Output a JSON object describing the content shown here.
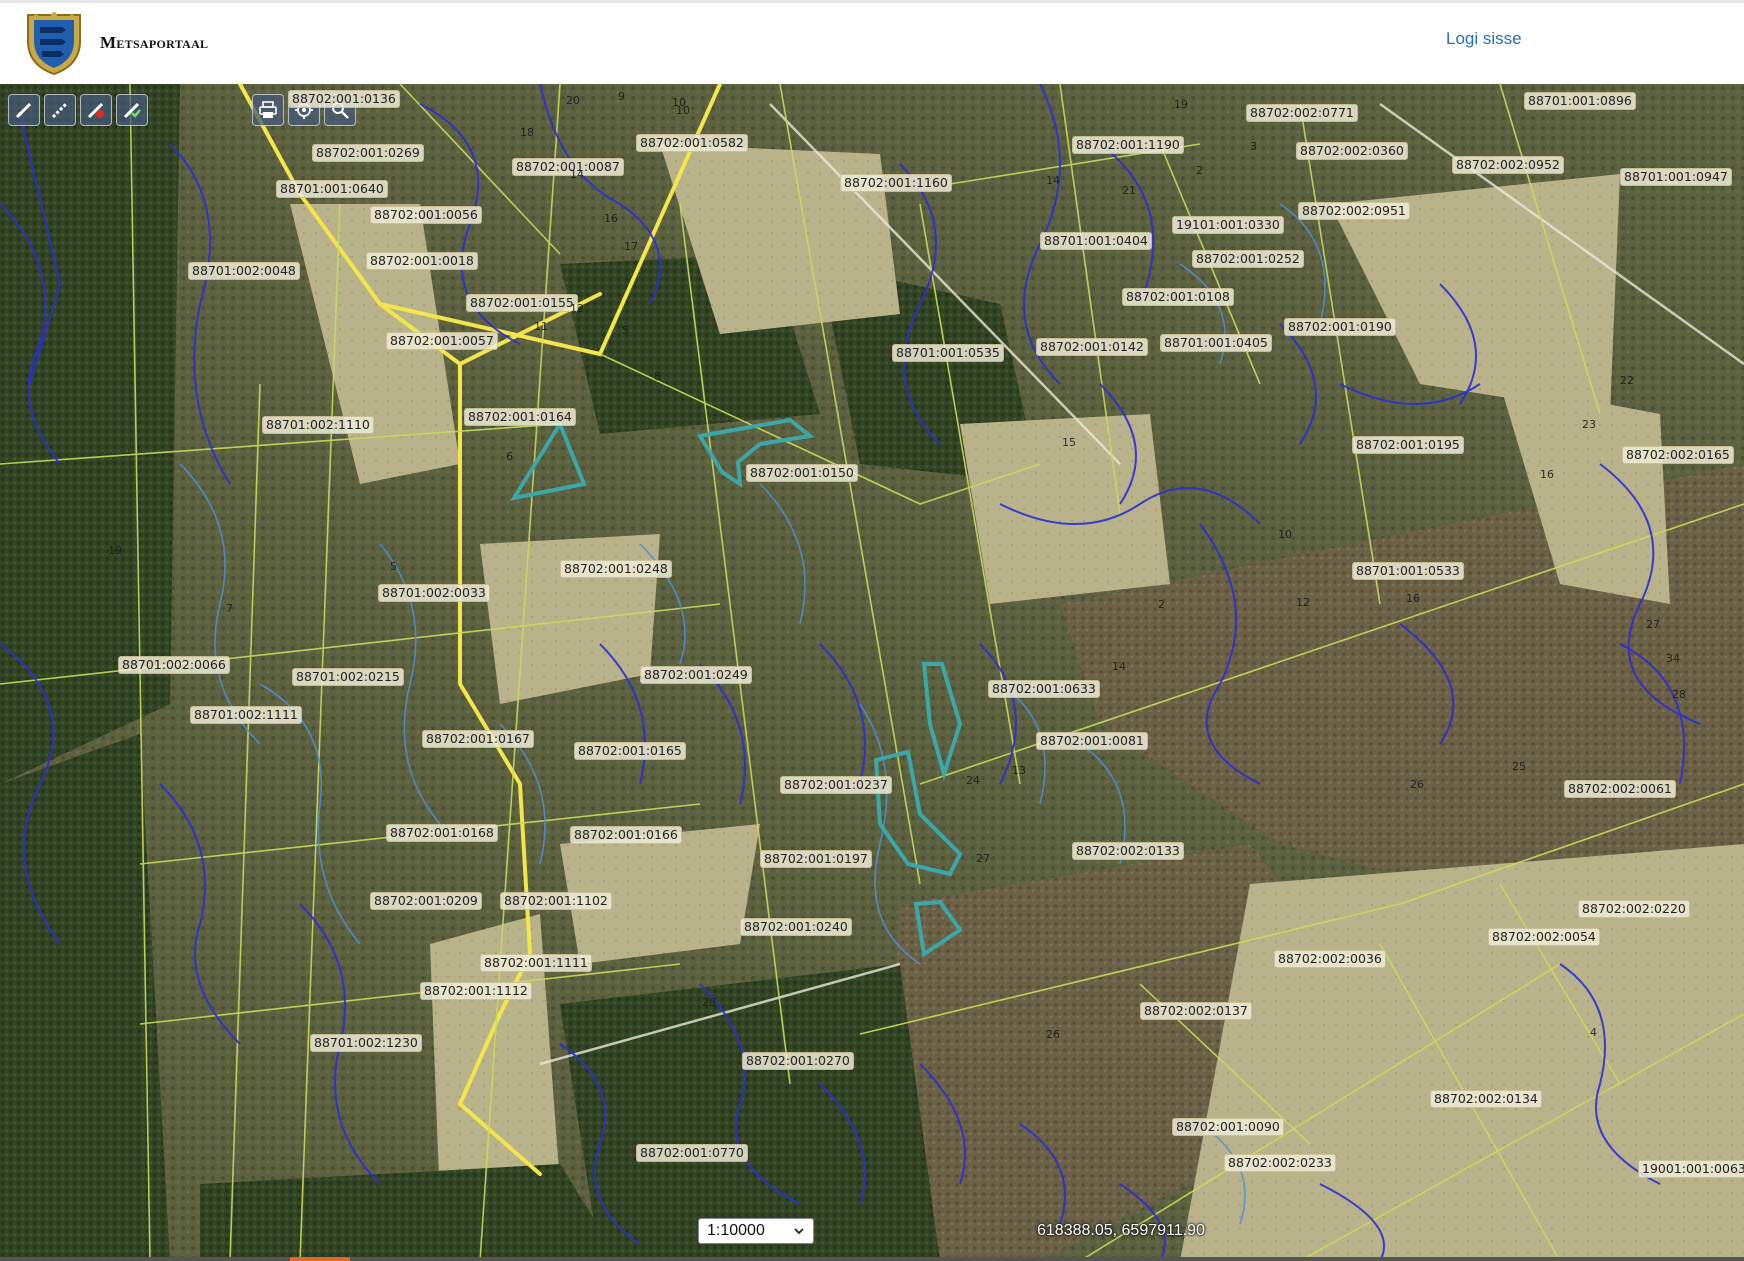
{
  "header": {
    "site_title": "Metsaportaal",
    "login_link": "Logi sisse",
    "logo_icon": "estonia-coat-of-arms-icon"
  },
  "map": {
    "edit_tools": [
      {
        "icon": "draw-line-icon"
      },
      {
        "icon": "edit-line-icon"
      },
      {
        "icon": "delete-line-icon"
      },
      {
        "icon": "confirm-line-icon"
      }
    ],
    "view_tools": [
      {
        "icon": "print-icon"
      },
      {
        "icon": "locate-icon"
      },
      {
        "icon": "zoom-icon"
      }
    ],
    "scale": "1:10000",
    "coordinates": "618388.05, 6597911.90",
    "parcel_labels": [
      "88702:001:0136",
      "88702:001:0269",
      "88701:001:0640",
      "88702:001:0056",
      "88702:001:0018",
      "88701:002:0048",
      "88702:001:0155",
      "88702:001:0057",
      "88702:001:0087",
      "88702:001:0582",
      "88702:001:1160",
      "88702:001:1190",
      "88702:002:0771",
      "88702:002:0360",
      "88701:001:0896",
      "88702:002:0952",
      "88701:001:0947",
      "88702:002:0951",
      "19101:001:0330",
      "88701:001:0404",
      "88702:001:0252",
      "88702:001:0108",
      "88702:001:0190",
      "88701:001:0405",
      "88702:001:0142",
      "88701:001:0535",
      "88701:002:1110",
      "88702:001:0164",
      "88702:001:0150",
      "88702:001:0195",
      "88702:002:0165",
      "88701:001:0533",
      "88702:001:0248",
      "88701:002:0033",
      "88701:002:0066",
      "88701:002:0215",
      "88702:001:0249",
      "88701:002:1111",
      "88702:001:0633",
      "88702:001:0167",
      "88702:001:0165",
      "88702:001:0081",
      "88702:001:0237",
      "88702:001:0166",
      "88702:001:0168",
      "88702:001:0197",
      "88702:002:0133",
      "88702:002:0061",
      "88702:001:0209",
      "88702:001:1102",
      "88702:001:0240",
      "88702:002:0220",
      "88702:002:0054",
      "88702:001:1111",
      "88702:002:0036",
      "88702:001:1112",
      "88702:002:0137",
      "88701:002:1230",
      "88702:001:0270",
      "88702:002:0134",
      "88702:001:0090",
      "88702:001:0770",
      "88702:002:0233",
      "19001:001:0063"
    ],
    "unit_numbers": [
      "20",
      "9",
      "10",
      "18",
      "14",
      "16",
      "17",
      "12",
      "11",
      "5",
      "8",
      "10",
      "19",
      "3",
      "2",
      "21",
      "14",
      "15",
      "16",
      "10",
      "12",
      "23",
      "27",
      "34",
      "25",
      "28",
      "26",
      "24",
      "27",
      "22",
      "4",
      "6",
      "2",
      "14",
      "26",
      "28",
      "19",
      "7",
      "5",
      "13",
      "16"
    ]
  }
}
